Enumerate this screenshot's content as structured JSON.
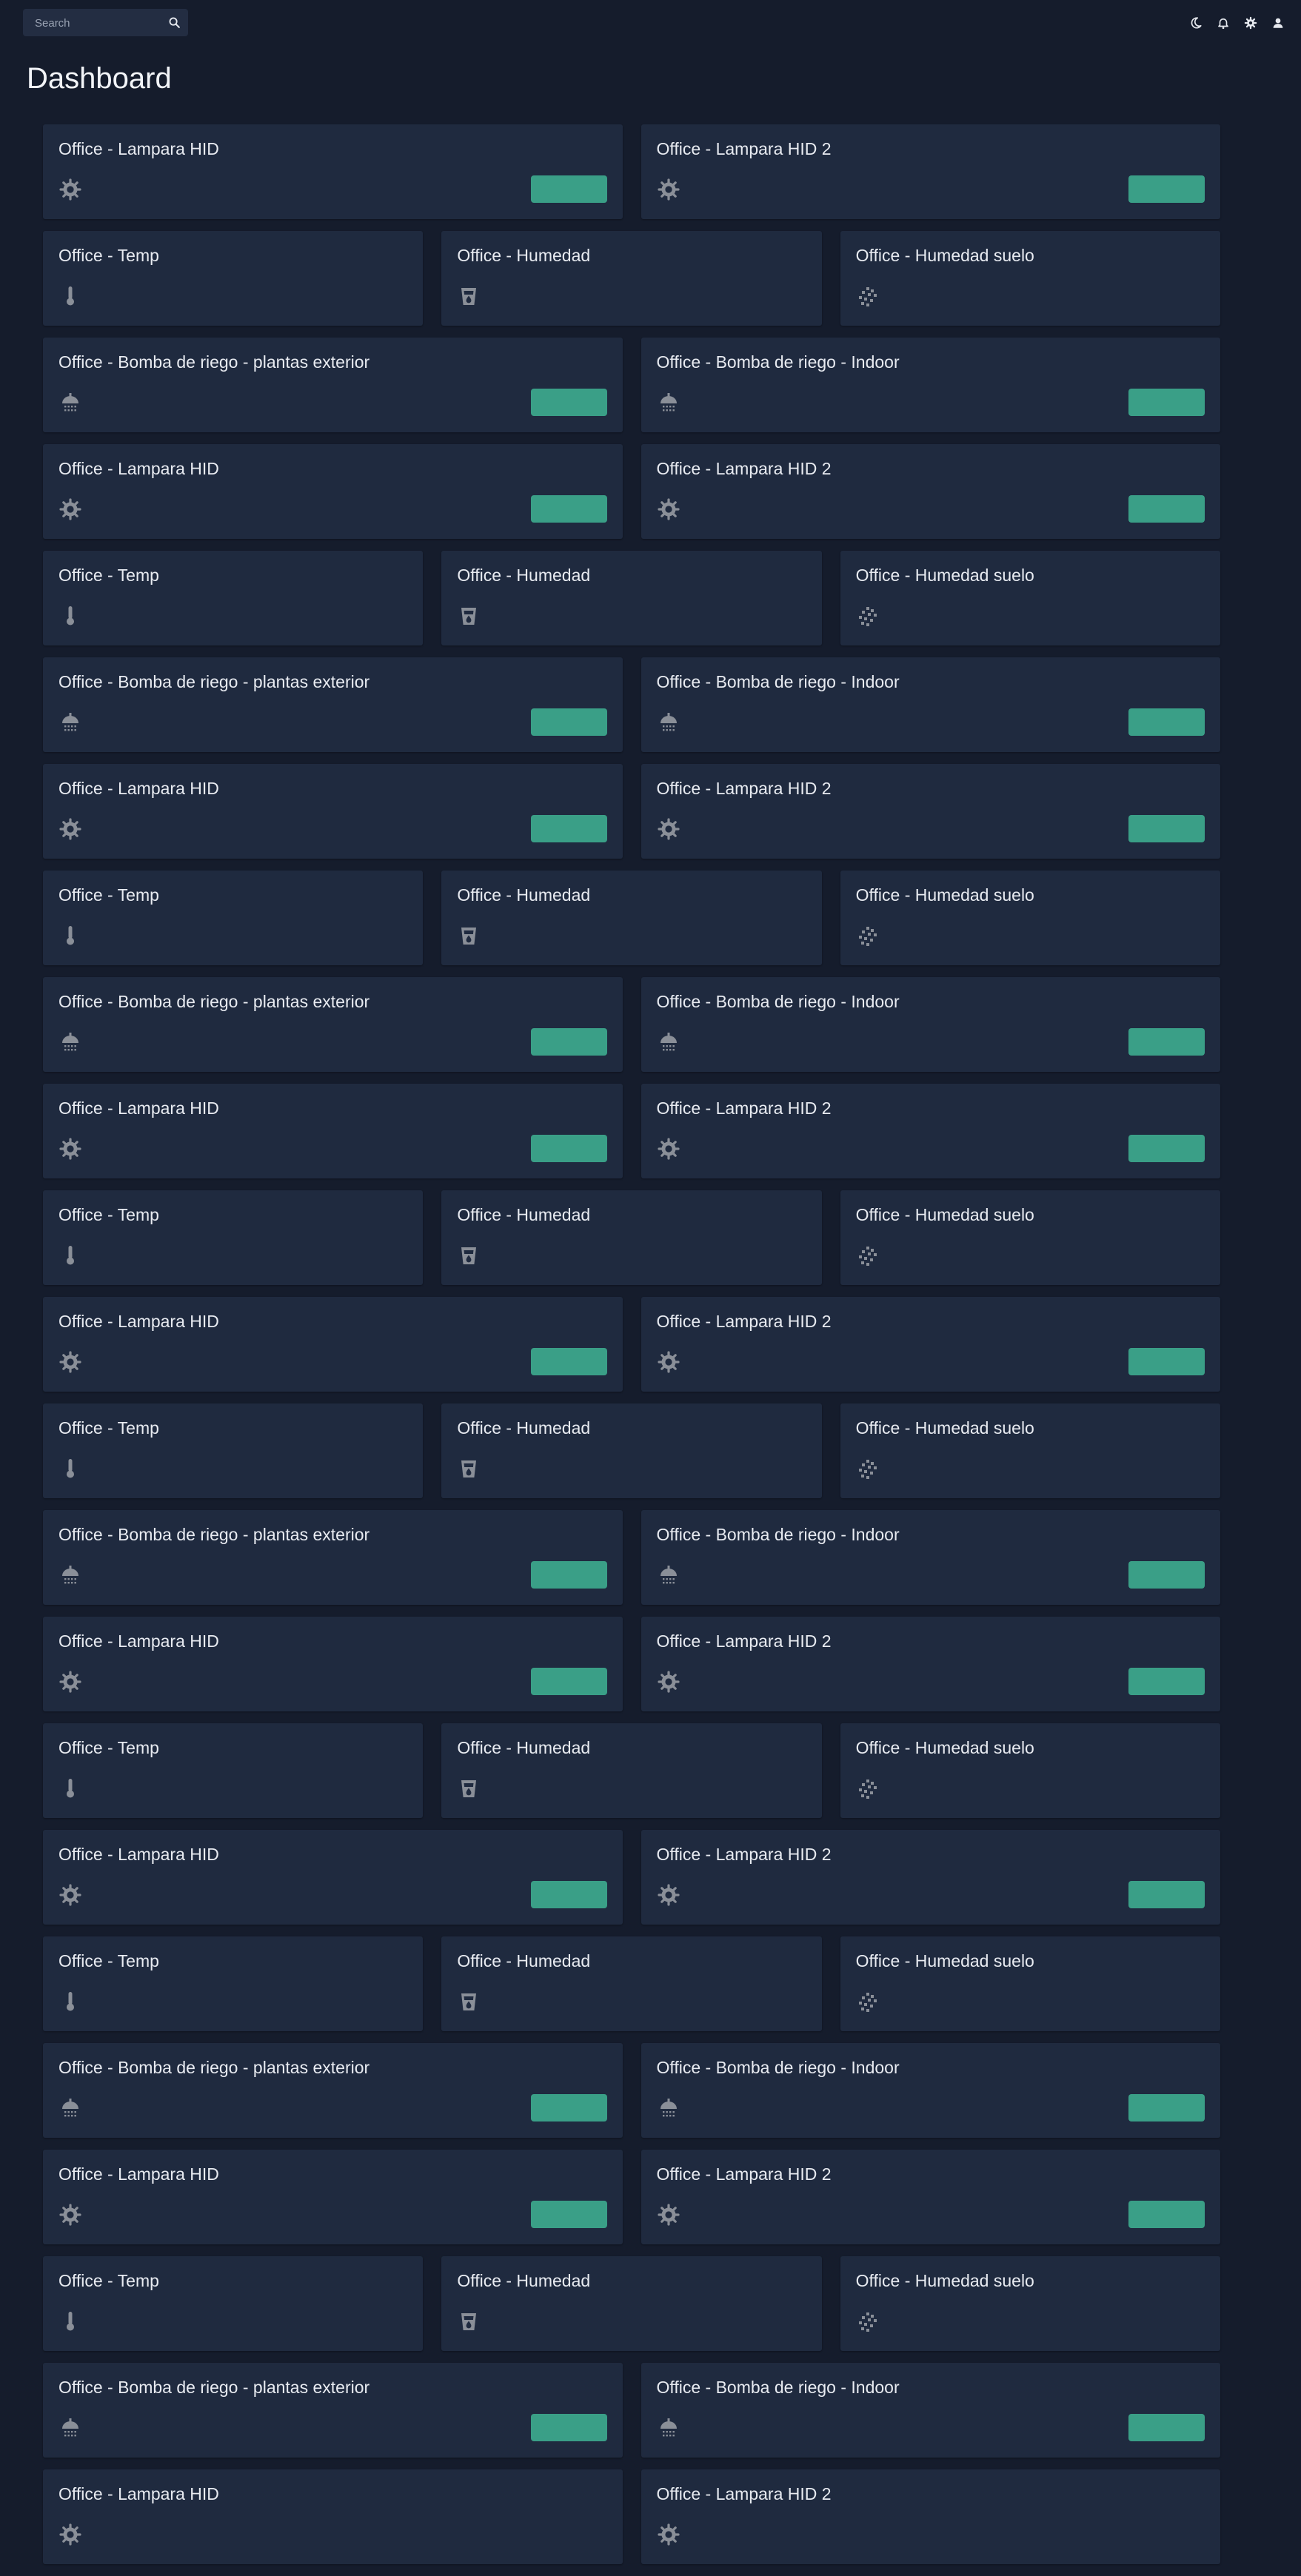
{
  "header": {
    "search_placeholder": "Search",
    "icons": [
      "moon-icon",
      "bell-icon",
      "gear-icon",
      "user-icon"
    ]
  },
  "page_title": "Dashboard",
  "colors": {
    "background": "#151c2c",
    "card": "#1f2a3f",
    "toggle": "#3a9f87",
    "icon": "#8a8f98"
  },
  "rows": [
    {
      "cards": [
        {
          "title": "Office - Lampara HID",
          "icon": "sun-icon",
          "toggle": true
        },
        {
          "title": "Office - Lampara HID 2",
          "icon": "sun-icon",
          "toggle": true
        }
      ]
    },
    {
      "cards": [
        {
          "title": "Office - Temp",
          "icon": "thermometer-icon",
          "toggle": false
        },
        {
          "title": "Office - Humedad",
          "icon": "water-glass-icon",
          "toggle": false
        },
        {
          "title": "Office - Humedad suelo",
          "icon": "soil-icon",
          "toggle": false
        }
      ]
    },
    {
      "cards": [
        {
          "title": "Office - Bomba de riego - plantas exterior",
          "icon": "shower-icon",
          "toggle": true
        },
        {
          "title": "Office - Bomba de riego - Indoor",
          "icon": "shower-icon",
          "toggle": true
        }
      ]
    },
    {
      "cards": [
        {
          "title": "Office - Lampara HID",
          "icon": "sun-icon",
          "toggle": true
        },
        {
          "title": "Office - Lampara HID 2",
          "icon": "sun-icon",
          "toggle": true
        }
      ]
    },
    {
      "cards": [
        {
          "title": "Office - Temp",
          "icon": "thermometer-icon",
          "toggle": false
        },
        {
          "title": "Office - Humedad",
          "icon": "water-glass-icon",
          "toggle": false
        },
        {
          "title": "Office - Humedad suelo",
          "icon": "soil-icon",
          "toggle": false
        }
      ]
    },
    {
      "cards": [
        {
          "title": "Office - Bomba de riego - plantas exterior",
          "icon": "shower-icon",
          "toggle": true
        },
        {
          "title": "Office - Bomba de riego - Indoor",
          "icon": "shower-icon",
          "toggle": true
        }
      ]
    },
    {
      "cards": [
        {
          "title": "Office - Lampara HID",
          "icon": "sun-icon",
          "toggle": true
        },
        {
          "title": "Office - Lampara HID 2",
          "icon": "sun-icon",
          "toggle": true
        }
      ]
    },
    {
      "cards": [
        {
          "title": "Office - Temp",
          "icon": "thermometer-icon",
          "toggle": false
        },
        {
          "title": "Office - Humedad",
          "icon": "water-glass-icon",
          "toggle": false
        },
        {
          "title": "Office - Humedad suelo",
          "icon": "soil-icon",
          "toggle": false
        }
      ]
    },
    {
      "cards": [
        {
          "title": "Office - Bomba de riego - plantas exterior",
          "icon": "shower-icon",
          "toggle": true
        },
        {
          "title": "Office - Bomba de riego - Indoor",
          "icon": "shower-icon",
          "toggle": true
        }
      ]
    },
    {
      "cards": [
        {
          "title": "Office - Lampara HID",
          "icon": "sun-icon",
          "toggle": true
        },
        {
          "title": "Office - Lampara HID 2",
          "icon": "sun-icon",
          "toggle": true
        }
      ]
    },
    {
      "cards": [
        {
          "title": "Office - Temp",
          "icon": "thermometer-icon",
          "toggle": false
        },
        {
          "title": "Office - Humedad",
          "icon": "water-glass-icon",
          "toggle": false
        },
        {
          "title": "Office - Humedad suelo",
          "icon": "soil-icon",
          "toggle": false
        }
      ]
    },
    {
      "cards": [
        {
          "title": "Office - Lampara HID",
          "icon": "sun-icon",
          "toggle": true
        },
        {
          "title": "Office - Lampara HID 2",
          "icon": "sun-icon",
          "toggle": true
        }
      ]
    },
    {
      "cards": [
        {
          "title": "Office - Temp",
          "icon": "thermometer-icon",
          "toggle": false
        },
        {
          "title": "Office - Humedad",
          "icon": "water-glass-icon",
          "toggle": false
        },
        {
          "title": "Office - Humedad suelo",
          "icon": "soil-icon",
          "toggle": false
        }
      ]
    },
    {
      "cards": [
        {
          "title": "Office - Bomba de riego - plantas exterior",
          "icon": "shower-icon",
          "toggle": true
        },
        {
          "title": "Office - Bomba de riego - Indoor",
          "icon": "shower-icon",
          "toggle": true
        }
      ]
    },
    {
      "cards": [
        {
          "title": "Office - Lampara HID",
          "icon": "sun-icon",
          "toggle": true
        },
        {
          "title": "Office - Lampara HID 2",
          "icon": "sun-icon",
          "toggle": true
        }
      ]
    },
    {
      "cards": [
        {
          "title": "Office - Temp",
          "icon": "thermometer-icon",
          "toggle": false
        },
        {
          "title": "Office - Humedad",
          "icon": "water-glass-icon",
          "toggle": false
        },
        {
          "title": "Office - Humedad suelo",
          "icon": "soil-icon",
          "toggle": false
        }
      ]
    },
    {
      "cards": [
        {
          "title": "Office - Lampara HID",
          "icon": "sun-icon",
          "toggle": true
        },
        {
          "title": "Office - Lampara HID 2",
          "icon": "sun-icon",
          "toggle": true
        }
      ]
    },
    {
      "cards": [
        {
          "title": "Office - Temp",
          "icon": "thermometer-icon",
          "toggle": false
        },
        {
          "title": "Office - Humedad",
          "icon": "water-glass-icon",
          "toggle": false
        },
        {
          "title": "Office - Humedad suelo",
          "icon": "soil-icon",
          "toggle": false
        }
      ]
    },
    {
      "cards": [
        {
          "title": "Office - Bomba de riego - plantas exterior",
          "icon": "shower-icon",
          "toggle": true
        },
        {
          "title": "Office - Bomba de riego - Indoor",
          "icon": "shower-icon",
          "toggle": true
        }
      ]
    },
    {
      "cards": [
        {
          "title": "Office - Lampara HID",
          "icon": "sun-icon",
          "toggle": true
        },
        {
          "title": "Office - Lampara HID 2",
          "icon": "sun-icon",
          "toggle": true
        }
      ]
    },
    {
      "cards": [
        {
          "title": "Office - Temp",
          "icon": "thermometer-icon",
          "toggle": false
        },
        {
          "title": "Office - Humedad",
          "icon": "water-glass-icon",
          "toggle": false
        },
        {
          "title": "Office - Humedad suelo",
          "icon": "soil-icon",
          "toggle": false
        }
      ]
    },
    {
      "cards": [
        {
          "title": "Office - Bomba de riego - plantas exterior",
          "icon": "shower-icon",
          "toggle": true
        },
        {
          "title": "Office - Bomba de riego - Indoor",
          "icon": "shower-icon",
          "toggle": true
        }
      ]
    },
    {
      "cards": [
        {
          "title": "Office - Lampara HID",
          "icon": "sun-icon",
          "toggle": false
        },
        {
          "title": "Office - Lampara HID 2",
          "icon": "sun-icon",
          "toggle": false
        }
      ]
    }
  ]
}
